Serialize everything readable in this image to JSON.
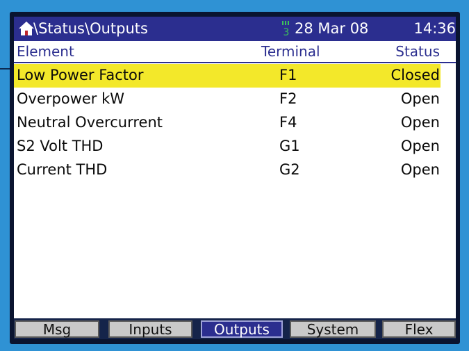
{
  "titlebar": {
    "path": "\\Status\\Outputs",
    "port_indicator": "3",
    "date": "28 Mar 08",
    "time": "14:36"
  },
  "table": {
    "headers": {
      "element": "Element",
      "terminal": "Terminal",
      "status": "Status"
    },
    "rows": [
      {
        "element": "Low Power Factor",
        "terminal": "F1",
        "status": "Closed",
        "selected": true
      },
      {
        "element": "Overpower kW",
        "terminal": "F2",
        "status": "Open",
        "selected": false
      },
      {
        "element": "Neutral Overcurrent",
        "terminal": "F4",
        "status": "Open",
        "selected": false
      },
      {
        "element": "S2 Volt THD",
        "terminal": "G1",
        "status": "Open",
        "selected": false
      },
      {
        "element": "Current THD",
        "terminal": "G2",
        "status": "Open",
        "selected": false
      }
    ]
  },
  "tabs": [
    {
      "label": "Msg",
      "active": false
    },
    {
      "label": "Inputs",
      "active": false
    },
    {
      "label": "Outputs",
      "active": true
    },
    {
      "label": "System",
      "active": false
    },
    {
      "label": "Flex",
      "active": false
    }
  ],
  "colors": {
    "bezel": "#2f92d4",
    "title_bar": "#2b2e8f",
    "selection_highlight": "#f3e82a",
    "port_indicator": "#3cc25a"
  },
  "icons": [
    "home-icon",
    "port-status-icon"
  ]
}
